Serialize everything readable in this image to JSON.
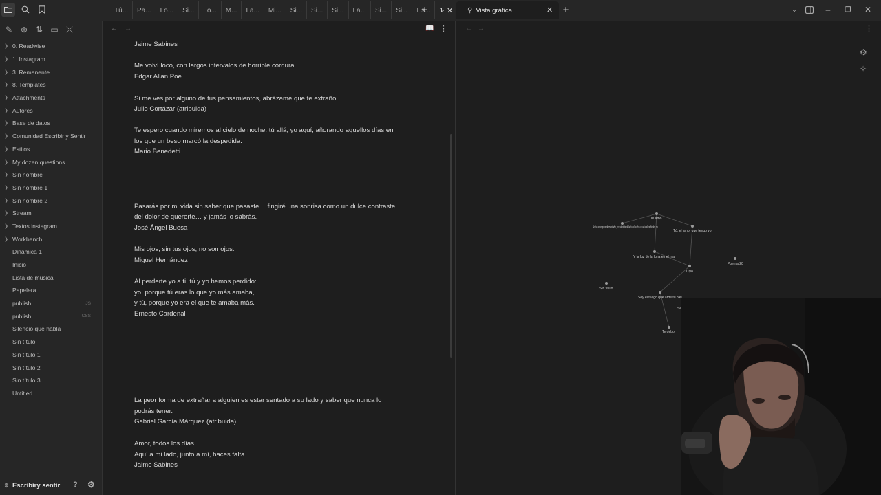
{
  "left_tabs": [
    "Tú...",
    "Pa...",
    "Lo...",
    "Si...",
    "Lo...",
    "M...",
    "La...",
    "Mi...",
    "Si...",
    "Si...",
    "Si...",
    "La...",
    "Si...",
    "Si...",
    "Es...",
    "1"
  ],
  "right_tab": {
    "label": "Vista gráfica"
  },
  "sidebar": {
    "folders": [
      "0. Readwise",
      "1. Instagram",
      "3. Remanente",
      "8. Templates",
      "Attachments",
      "Autores",
      "Base de datos",
      "Comunidad Escribir y Sentir",
      "Estilos",
      "My dozen questions",
      "Sin nombre",
      "Sin nombre 1",
      "Sin nombre 2",
      "Stream",
      "Textos instagram",
      "Workbench"
    ],
    "files": [
      {
        "name": "Dinámica 1",
        "ext": ""
      },
      {
        "name": "Inicio",
        "ext": ""
      },
      {
        "name": "Lista de música",
        "ext": ""
      },
      {
        "name": "Papelera",
        "ext": ""
      },
      {
        "name": "publish",
        "ext": "JS"
      },
      {
        "name": "publish",
        "ext": "CSS"
      },
      {
        "name": "Silencio que habla",
        "ext": ""
      },
      {
        "name": "Sin título",
        "ext": ""
      },
      {
        "name": "Sin título 1",
        "ext": ""
      },
      {
        "name": "Sin título 2",
        "ext": ""
      },
      {
        "name": "Sin título 3",
        "ext": ""
      },
      {
        "name": "Untitled",
        "ext": ""
      }
    ],
    "vault_name": "Escribiry sentir"
  },
  "editor": {
    "lines": [
      "Jaime Sabines",
      "Me volví loco, con largos intervalos de horrible cordura.",
      "Edgar Allan Poe",
      "Si me ves por alguno de tus pensamientos, abrázame que te extraño.",
      "Julio Cortázar (atribuida)",
      "Te espero cuando miremos al cielo de noche: tú allá, yo aquí, añorando aquellos días en",
      "los que un beso marcó la despedida.",
      "Mario Benedetti",
      "Pasarás por mi vida sin saber que pasaste… fingiré una sonrisa como un dulce contraste",
      "del dolor de quererte… y jamás lo sabrás.",
      "José Ángel Buesa",
      "Mis ojos, sin tus ojos, no son ojos.",
      "Miguel Hernández",
      "Al perderte yo a ti, tú y yo hemos perdido:",
      "yo, porque tú eras lo que yo más amaba,",
      "y tú, porque yo era el que te amaba más.",
      "Ernesto Cardenal",
      "La peor forma de extrañar a alguien es estar sentado a su lado y saber que nunca lo",
      "podrás tener.",
      "Gabriel García Márquez (atribuida)",
      "Amor, todos los días.",
      "Aquí a mi lado, junto a mí, haces falta.",
      "Jaime Sabines"
    ]
  },
  "graph": {
    "nodes": [
      {
        "label": "Te amo"
      },
      {
        "label": "No te acerques demasiado, no sé si te dolería el techo o veía el radiador de"
      },
      {
        "label": "Tú, el amor que tengo yo"
      },
      {
        "label": "Y la luz de la luna en el mar"
      },
      {
        "label": "Tuyo"
      },
      {
        "label": "Poema 20"
      },
      {
        "label": "Sin título"
      },
      {
        "label": "Soy el fuego que arde tu piel"
      },
      {
        "label": "Se"
      },
      {
        "label": "Te debo"
      }
    ]
  }
}
